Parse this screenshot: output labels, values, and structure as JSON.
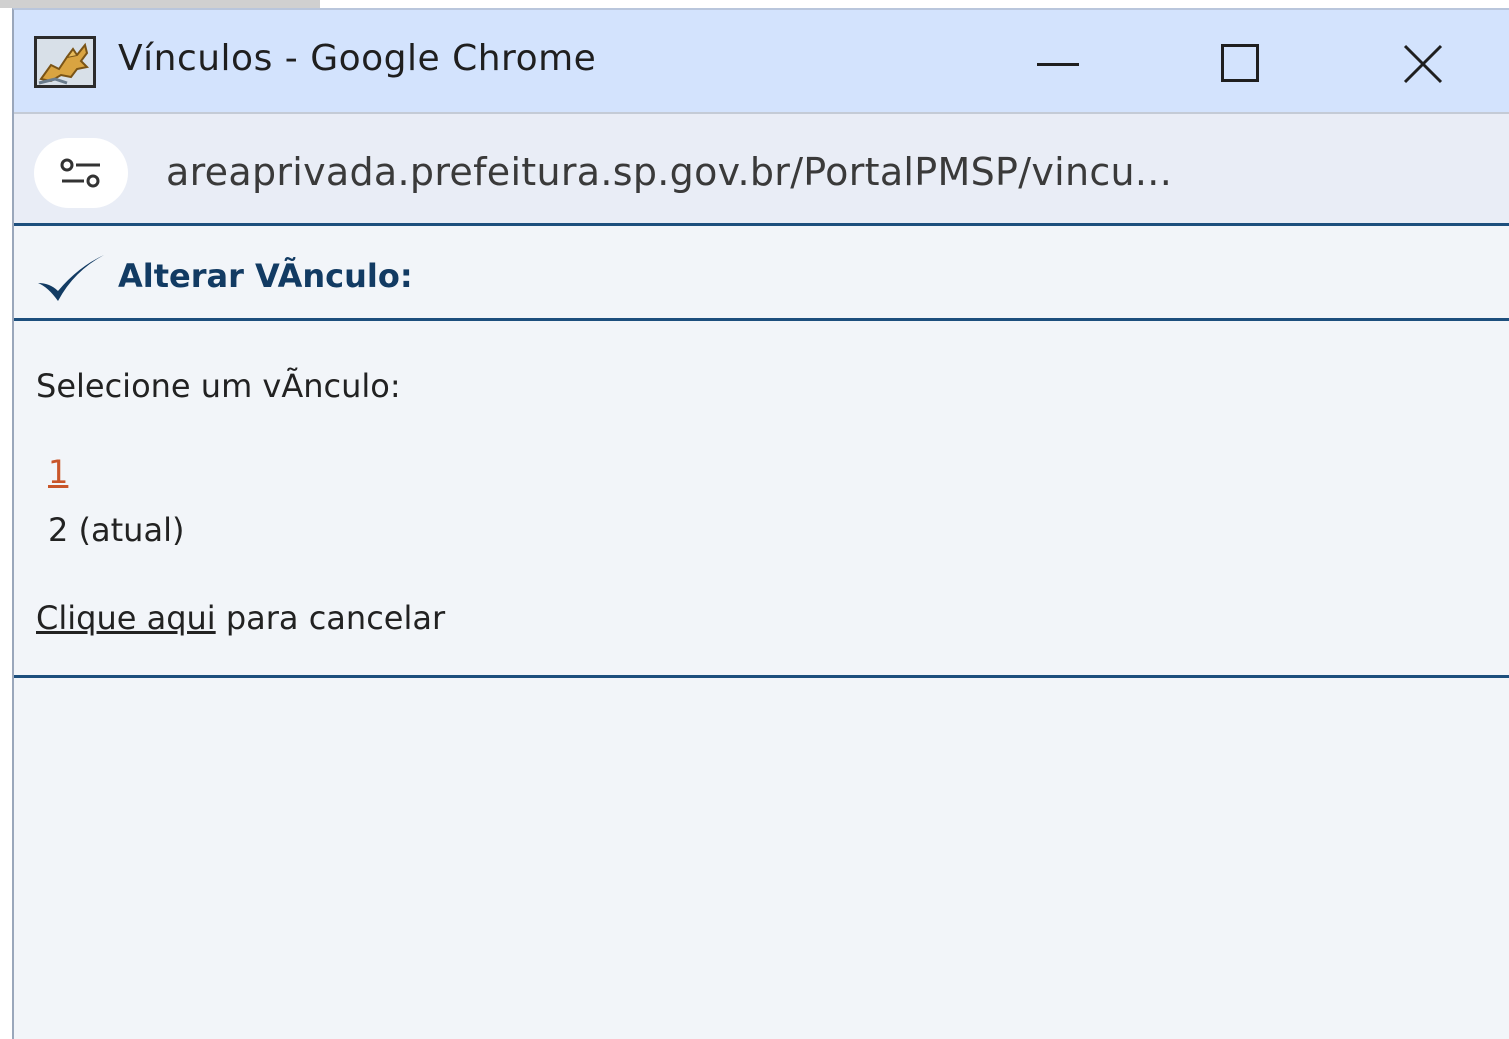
{
  "window": {
    "title": "Vínculos - Google Chrome",
    "app_icon": "tomcat-icon",
    "controls": {
      "minimize_icon": "minimize-icon",
      "maximize_icon": "maximize-icon",
      "close_icon": "close-icon"
    }
  },
  "address_bar": {
    "site_info_icon": "tune-icon",
    "url": "areaprivada.prefeitura.sp.gov.br/PortalPMSP/vincu..."
  },
  "page": {
    "header": {
      "icon": "checkmark-icon",
      "title": "Alterar VÃnculo:"
    },
    "prompt": "Selecione um vÃnculo:",
    "options": [
      {
        "label": "1",
        "is_link": true
      },
      {
        "label": "2 (atual)",
        "is_link": false
      }
    ],
    "cancel": {
      "link_text": "Clique aqui",
      "rest_text": " para cancelar"
    }
  },
  "colors": {
    "titlebar_bg": "#d3e3fd",
    "addressbar_bg": "#e9edf6",
    "page_bg": "#f2f5f9",
    "divider": "#1d4f7d",
    "heading": "#123b63",
    "link_visited": "#c9562a"
  }
}
